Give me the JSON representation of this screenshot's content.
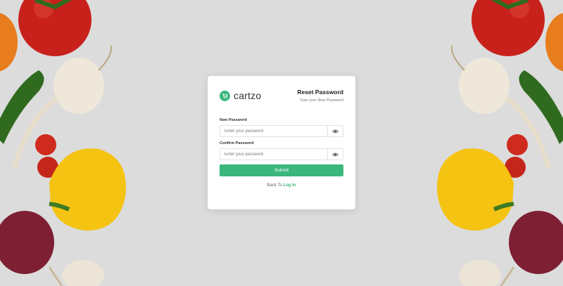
{
  "brand": {
    "name": "cartzo",
    "icon": "cart-icon",
    "color": "#3bb77e"
  },
  "header": {
    "title": "Reset Password",
    "subtitle": "Type your New Password"
  },
  "form": {
    "new_password": {
      "label": "New Password",
      "placeholder": "Enter your password",
      "value": "",
      "toggle_icon": "eye-icon"
    },
    "confirm_password": {
      "label": "Confirm Password",
      "placeholder": "Enter your password",
      "value": "",
      "toggle_icon": "eye-icon"
    },
    "submit_label": "Submit"
  },
  "footer": {
    "back_text": "Back To",
    "login_link": "Log In"
  }
}
